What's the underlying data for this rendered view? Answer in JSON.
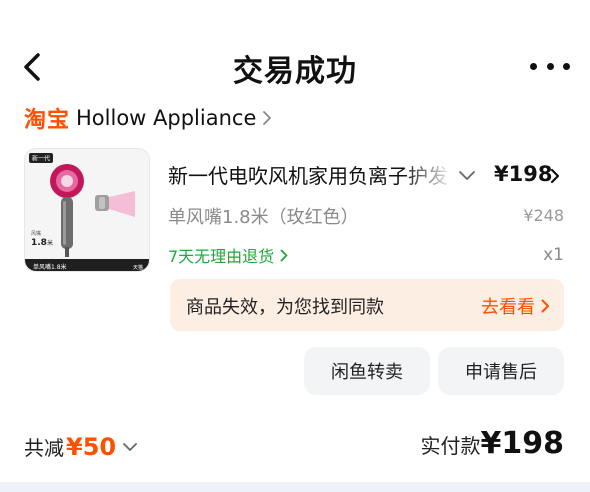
{
  "nav": {
    "title": "交易成功"
  },
  "shop": {
    "logo_text": "淘宝",
    "name": "Hollow Appliance"
  },
  "thumbnail": {
    "top_badge": "新一代",
    "size_label": "1.8",
    "size_unit": "米",
    "caption": "单风嘴1.8米",
    "caption_right": "天猫"
  },
  "item": {
    "title": "新一代电吹风机家用负离子护发",
    "price": "¥198",
    "sku": "单风嘴1.8米（玫红色）",
    "original_price": "¥248",
    "return_policy": "7天无理由退货",
    "quantity": "x1"
  },
  "invalid_notice": {
    "text": "商品失效，为您找到同款",
    "link": "去看看"
  },
  "buttons": {
    "resell": "闲鱼转卖",
    "after_sale": "申请售后"
  },
  "summary": {
    "discount_label": "共减",
    "discount_value": "¥50",
    "paid_label": "实付款",
    "paid_value": "¥198"
  },
  "colors": {
    "accent": "#ff5000",
    "green": "#22a83a",
    "notice_bg": "#fdeee4",
    "button_bg": "#f3f4f6"
  },
  "icons": {
    "back": "chevron-left-icon",
    "more": "more-dots-icon",
    "chevron_right": "chevron-right-icon",
    "chevron_down": "chevron-down-icon"
  }
}
